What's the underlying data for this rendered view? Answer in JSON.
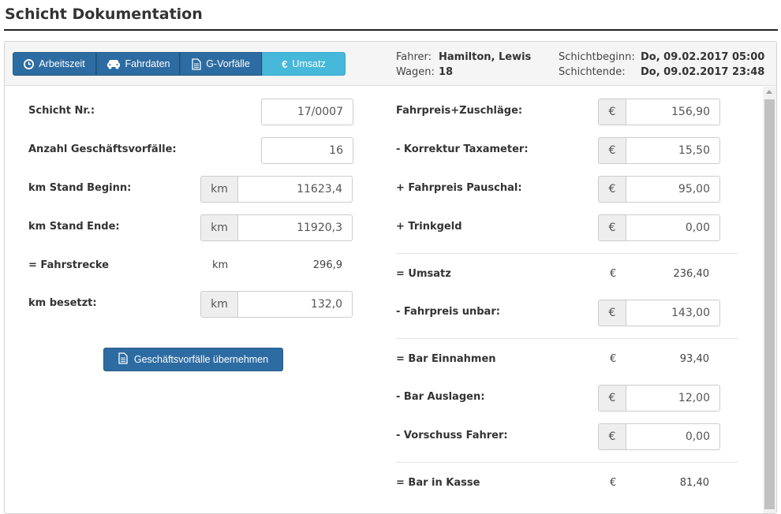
{
  "page": {
    "title": "Schicht Dokumentation"
  },
  "tabs": [
    {
      "label": "Arbeitszeit",
      "icon": "clock-icon"
    },
    {
      "label": "Fahrdaten",
      "icon": "car-icon"
    },
    {
      "label": "G-Vorfälle",
      "icon": "document-icon"
    },
    {
      "label": "Umsatz",
      "icon": "euro-icon",
      "glyph": "€",
      "active": true
    }
  ],
  "meta": {
    "driver_label": "Fahrer:",
    "driver": "Hamilton, Lewis",
    "car_label": "Wagen:",
    "car": "18",
    "start_label": "Schichtbeginn:",
    "start": "Do, 09.02.2017 05:00",
    "end_label": "Schichtende:",
    "end": "Do, 09.02.2017 23:48"
  },
  "left": {
    "shift_no": {
      "label": "Schicht Nr.:",
      "value": "17/0007"
    },
    "transactions": {
      "label": "Anzahl Geschäftsvorfälle:",
      "value": "16"
    },
    "km_start": {
      "label": "km Stand Beginn:",
      "unit": "km",
      "value": "11623,4"
    },
    "km_end": {
      "label": "km Stand Ende:",
      "unit": "km",
      "value": "11920,3"
    },
    "distance": {
      "label": "= Fahrstrecke",
      "unit": "km",
      "value": "296,9"
    },
    "km_occupied": {
      "label": "km besetzt:",
      "unit": "km",
      "value": "132,0"
    },
    "apply_button": "Geschäftsvorfälle übernehmen"
  },
  "right": {
    "currency": "€",
    "fare_surcharges": {
      "label": "Fahrpreis+Zuschläge:",
      "value": "156,90"
    },
    "meter_correction": {
      "label": "- Korrektur Taxameter:",
      "value": "15,50"
    },
    "flat_fare": {
      "label": "+ Fahrpreis Pauschal:",
      "value": "95,00"
    },
    "tip": {
      "label": "+ Trinkgeld",
      "value": "0,00"
    },
    "revenue": {
      "label": "= Umsatz",
      "value": "236,40"
    },
    "cashless": {
      "label": "- Fahrpreis unbar:",
      "value": "143,00"
    },
    "cash_income": {
      "label": "= Bar Einnahmen",
      "value": "93,40"
    },
    "cash_expenses": {
      "label": "- Bar Auslagen:",
      "value": "12,00"
    },
    "driver_advance": {
      "label": "- Vorschuss Fahrer:",
      "value": "0,00"
    },
    "cash_in_till": {
      "label": "= Bar in Kasse",
      "value": "81,40"
    }
  }
}
